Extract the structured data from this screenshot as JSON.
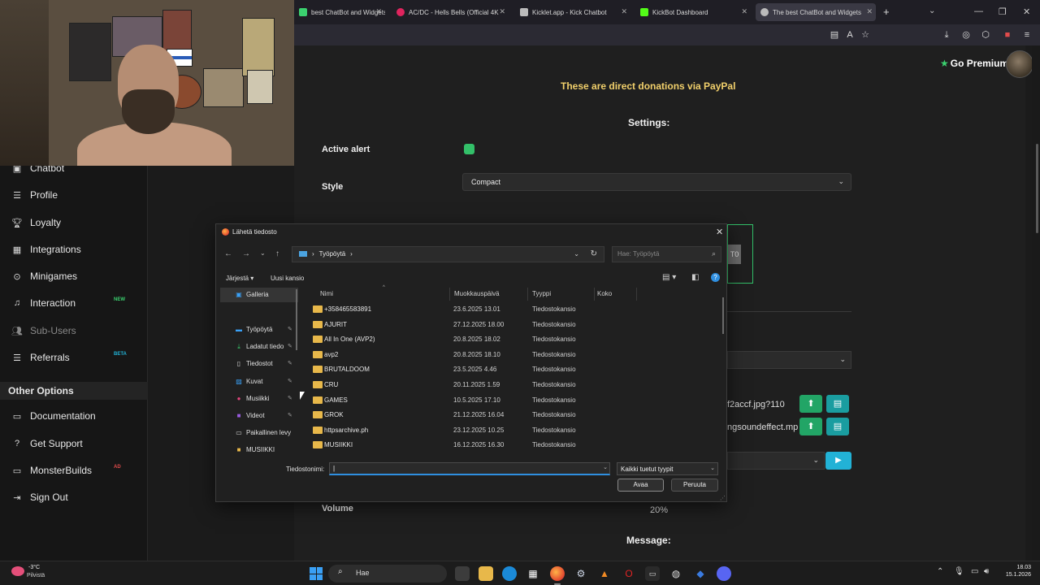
{
  "browser": {
    "tabs": [
      {
        "label": "best ChatBot and Widgets",
        "color": "#3bd16f"
      },
      {
        "label": "AC/DC - Hells Bells (Official 4K",
        "color": "#e0245e"
      },
      {
        "label": "Kicklet.app - Kick Chatbot",
        "color": "#bbbbbb"
      },
      {
        "label": "KickBot Dashboard",
        "color": "#53fc18"
      },
      {
        "label": "The best ChatBot and Widgets",
        "color": "#bbbbbb"
      }
    ],
    "new_tab": "+",
    "tab_close": "✕"
  },
  "header": {
    "premium_label": "Go Premium"
  },
  "sidebar": {
    "items": [
      {
        "label": "Chatbot",
        "icon": "robot-icon"
      },
      {
        "label": "Profile",
        "icon": "list-icon"
      },
      {
        "label": "Loyalty",
        "icon": "trophy-icon"
      },
      {
        "label": "Integrations",
        "icon": "integration-icon"
      },
      {
        "label": "Minigames",
        "icon": "gamepad-icon"
      },
      {
        "label": "Interaction",
        "icon": "music-icon",
        "badge": "NEW"
      },
      {
        "label": "Sub-Users",
        "icon": "users-icon"
      },
      {
        "label": "Referrals",
        "icon": "referrals-icon",
        "badge": "BETA"
      }
    ],
    "other_options": "Other Options",
    "other_items": [
      {
        "label": "Documentation",
        "icon": "book-icon"
      },
      {
        "label": "Get Support",
        "icon": "help-icon"
      },
      {
        "label": "MonsterBuilds",
        "icon": "monitor-icon",
        "badge": "AD"
      },
      {
        "label": "Sign Out",
        "icon": "signout-icon"
      }
    ]
  },
  "main": {
    "paypal_note": "These are direct donations via PayPal",
    "settings_heading": "Settings:",
    "active_alert_label": "Active alert",
    "style_label": "Style",
    "style_value": "Compact",
    "file1": "f2accf.jpg?110",
    "file2": "ngsoundeffect.mp",
    "volume_label": "Volume",
    "volume_value": "20%",
    "message_heading": "Message:"
  },
  "dialog": {
    "title": "Lähetä tiedosto",
    "path": "Työpöytä",
    "search_placeholder": "Hae: Työpöytä",
    "organize": "Järjestä",
    "new_folder": "Uusi kansio",
    "nav_items": [
      {
        "label": "Galleria",
        "icon": "gallery-icon",
        "color": "#3aa0f5"
      },
      {
        "label": "Työpöytä",
        "icon": "desktop-icon",
        "color": "#3aa0f5"
      },
      {
        "label": "Ladatut tiedostot",
        "icon": "download-icon",
        "color": "#3bd16f"
      },
      {
        "label": "Tiedostot",
        "icon": "document-icon",
        "color": "#cfcfcf"
      },
      {
        "label": "Kuvat",
        "icon": "pictures-icon",
        "color": "#3aa0f5"
      },
      {
        "label": "Musiikki",
        "icon": "music-icon",
        "color": "#e0457b"
      },
      {
        "label": "Videot",
        "icon": "video-icon",
        "color": "#9a5ce0"
      },
      {
        "label": "Paikallinen levy",
        "icon": "drive-icon",
        "color": "#cfcfcf"
      },
      {
        "label": "MUSIIKKI",
        "icon": "folder-icon",
        "color": "#e8b84a"
      }
    ],
    "columns": [
      "Nimi",
      "Muokkauspäivä",
      "Tyyppi",
      "Koko"
    ],
    "files": [
      {
        "name": "+358465583891",
        "date": "23.6.2025 13.01",
        "type": "Tiedostokansio"
      },
      {
        "name": "AJURIT",
        "date": "27.12.2025 18.00",
        "type": "Tiedostokansio"
      },
      {
        "name": "All In One (AVP2)",
        "date": "20.8.2025 18.02",
        "type": "Tiedostokansio"
      },
      {
        "name": "avp2",
        "date": "20.8.2025 18.10",
        "type": "Tiedostokansio"
      },
      {
        "name": "BRUTALDOOM",
        "date": "23.5.2025 4.46",
        "type": "Tiedostokansio"
      },
      {
        "name": "CRU",
        "date": "20.11.2025 1.59",
        "type": "Tiedostokansio"
      },
      {
        "name": "GAMES",
        "date": "10.5.2025 17.10",
        "type": "Tiedostokansio"
      },
      {
        "name": "GROK",
        "date": "21.12.2025 16.04",
        "type": "Tiedostokansio"
      },
      {
        "name": "httpsarchive.ph",
        "date": "23.12.2025 10.25",
        "type": "Tiedostokansio"
      },
      {
        "name": "MUSIIKKI",
        "date": "16.12.2025 16.30",
        "type": "Tiedostokansio"
      }
    ],
    "filename_label": "Tiedostonimi:",
    "filename_value": "",
    "filetype_value": "Kaikki tuetut tyypit",
    "open_button": "Avaa",
    "cancel_button": "Peruuta"
  },
  "taskbar": {
    "temperature": "-3°C",
    "weather": "Pilvistä",
    "search_label": "Hae",
    "time": "18.03",
    "date": "15.1.2026"
  }
}
